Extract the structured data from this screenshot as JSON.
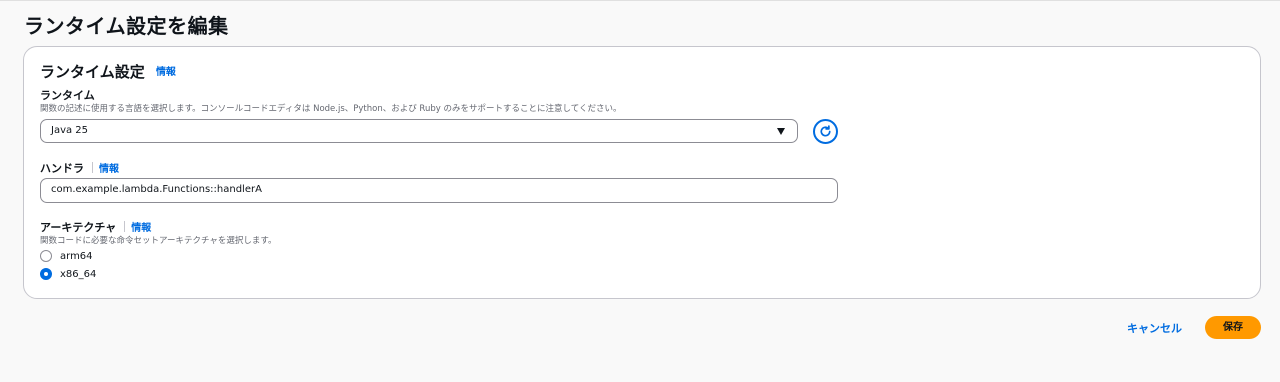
{
  "page": {
    "title": "ランタイム設定を編集"
  },
  "card": {
    "title": "ランタイム設定",
    "info": "情報"
  },
  "runtime": {
    "label": "ランタイム",
    "description": "関数の記述に使用する言語を選択します。コンソールコードエディタは Node.js、Python、および Ruby のみをサポートすることに注意してください。",
    "selected": "Java 25"
  },
  "handler": {
    "label": "ハンドラ",
    "info": "情報",
    "value": "com.example.lambda.Functions::handlerA"
  },
  "architecture": {
    "label": "アーキテクチャ",
    "info": "情報",
    "description": "関数コードに必要な命令セットアーキテクチャを選択します。",
    "options": [
      {
        "label": "arm64",
        "checked": false
      },
      {
        "label": "x86_64",
        "checked": true
      }
    ]
  },
  "actions": {
    "cancel": "キャンセル",
    "save": "保存"
  },
  "colors": {
    "accent": "#006ce0",
    "primary_button": "#ff9900"
  }
}
